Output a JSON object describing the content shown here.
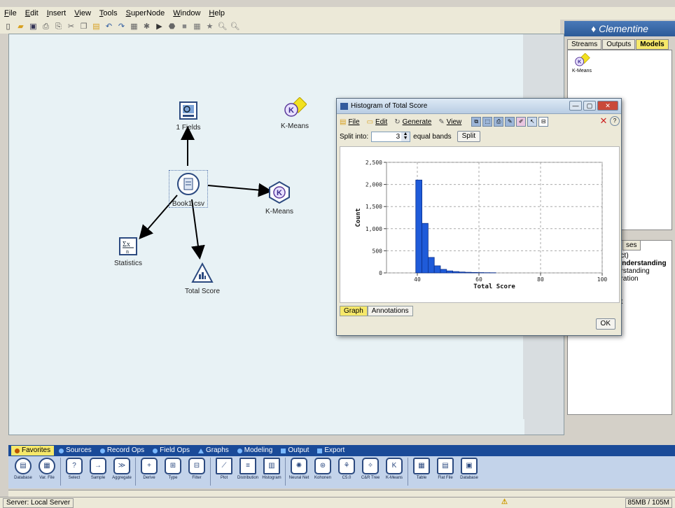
{
  "menu": [
    "File",
    "Edit",
    "Insert",
    "View",
    "Tools",
    "SuperNode",
    "Window",
    "Help"
  ],
  "stream": {
    "nodes": {
      "fields": "1 Fields",
      "kmeans_model": "K-Means",
      "source": "Book1.csv",
      "kmeans_modeling": "K-Means",
      "statistics": "Statistics",
      "total_score": "Total Score"
    }
  },
  "managers": {
    "brand": "Clementine",
    "tabs": [
      "Streams",
      "Outputs",
      "Models"
    ],
    "active_tab": "Models",
    "model_item": "K-Means",
    "projects": {
      "tab": "ses",
      "lines": [
        "ect)",
        "Understanding",
        "erstanding",
        "aration",
        "nt"
      ]
    }
  },
  "histogram": {
    "title": "Histogram of Total Score",
    "menu": {
      "file": "File",
      "edit": "Edit",
      "generate": "Generate",
      "view": "View"
    },
    "split_label": "Split into:",
    "split_value": "3",
    "bands_label": "equal bands",
    "split_button": "Split",
    "tabs": [
      "Graph",
      "Annotations"
    ],
    "ok_button": "OK"
  },
  "chart_data": {
    "type": "bar",
    "xlabel": "Total Score",
    "ylabel": "Count",
    "xlim": [
      30,
      100
    ],
    "ylim": [
      0,
      2500
    ],
    "xticks": [
      40,
      60,
      80,
      100
    ],
    "yticks": [
      0,
      500,
      1000,
      1500,
      2000,
      2500
    ],
    "ytick_labels": [
      "0",
      "500",
      "1,000",
      "1,500",
      "2,000",
      "2,500"
    ],
    "bin_width": 2,
    "bins": [
      {
        "x0": 39.5,
        "value": 2100
      },
      {
        "x0": 41.5,
        "value": 1120
      },
      {
        "x0": 43.5,
        "value": 350
      },
      {
        "x0": 45.5,
        "value": 160
      },
      {
        "x0": 47.5,
        "value": 80
      },
      {
        "x0": 49.5,
        "value": 45
      },
      {
        "x0": 51.5,
        "value": 30
      },
      {
        "x0": 53.5,
        "value": 20
      },
      {
        "x0": 55.5,
        "value": 14
      },
      {
        "x0": 57.5,
        "value": 10
      },
      {
        "x0": 59.5,
        "value": 7
      },
      {
        "x0": 61.5,
        "value": 5
      },
      {
        "x0": 63.5,
        "value": 4
      }
    ],
    "bar_color": "#1f5bd9",
    "grid": true
  },
  "palette": {
    "tabs": [
      "Favorites",
      "Sources",
      "Record Ops",
      "Field Ops",
      "Graphs",
      "Modeling",
      "Output",
      "Export"
    ],
    "active_tab": "Favorites",
    "items": [
      {
        "label": "Database",
        "icon": "database-icon",
        "glyph": "▤"
      },
      {
        "label": "Var. File",
        "icon": "file-icon",
        "glyph": "▦"
      },
      {
        "label": "Select",
        "icon": "select-icon",
        "glyph": "?"
      },
      {
        "label": "Sample",
        "icon": "sample-icon",
        "glyph": "→"
      },
      {
        "label": "Aggregate",
        "icon": "aggregate-icon",
        "glyph": "≫"
      },
      {
        "label": "Derive",
        "icon": "derive-icon",
        "glyph": "+"
      },
      {
        "label": "Type",
        "icon": "type-icon",
        "glyph": "⊞"
      },
      {
        "label": "Filter",
        "icon": "filter-icon",
        "glyph": "⊟"
      },
      {
        "label": "Plot",
        "icon": "plot-icon",
        "glyph": "⟋"
      },
      {
        "label": "Distribution",
        "icon": "distribution-icon",
        "glyph": "≡"
      },
      {
        "label": "Histogram",
        "icon": "histogram-icon",
        "glyph": "▥"
      },
      {
        "label": "Neural Net",
        "icon": "neural-net-icon",
        "glyph": "✺"
      },
      {
        "label": "Kohonen",
        "icon": "kohonen-icon",
        "glyph": "⊛"
      },
      {
        "label": "C5.0",
        "icon": "c50-icon",
        "glyph": "⚘"
      },
      {
        "label": "C&R Tree",
        "icon": "cr-tree-icon",
        "glyph": "✧"
      },
      {
        "label": "K-Means",
        "icon": "kmeans-icon",
        "glyph": "K"
      },
      {
        "label": "Table",
        "icon": "table-icon",
        "glyph": "▦"
      },
      {
        "label": "Flat File",
        "icon": "flat-file-icon",
        "glyph": "▤"
      },
      {
        "label": "Database",
        "icon": "database-export-icon",
        "glyph": "▣"
      }
    ]
  },
  "status": {
    "server": "Server: Local Server",
    "memory": "85MB / 105M"
  }
}
